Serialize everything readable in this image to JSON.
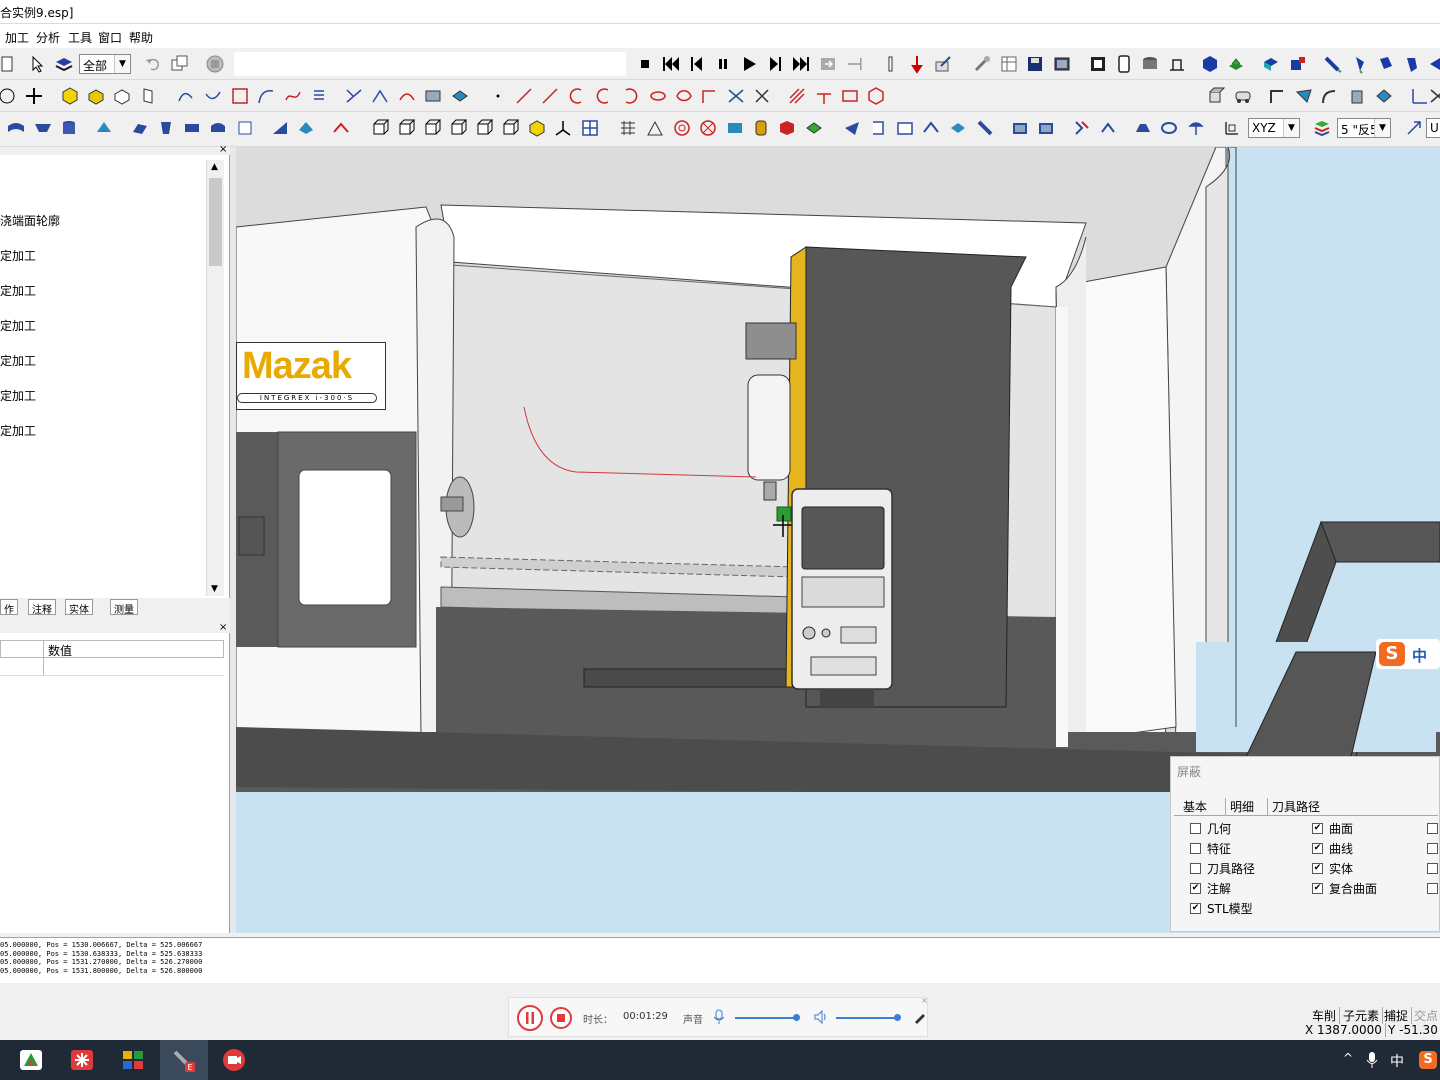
{
  "titlebar": {
    "title": "合实例9.esp]"
  },
  "menu": [
    "加工",
    "分析",
    "工具",
    "窗口",
    "帮助"
  ],
  "toolbar1": {
    "layer_combo": "全部"
  },
  "toolbar3": {
    "coord_combo": "XYZ",
    "view_combo": "5 \"反5"
  },
  "tree": {
    "items": [
      "浇端面轮廓",
      "定加工",
      "定加工",
      "定加工",
      "定加工",
      "定加工",
      "定加工"
    ]
  },
  "left_tabs": [
    "作",
    "注释",
    "实体",
    "测量"
  ],
  "props": {
    "header_value": "数值"
  },
  "viewport": {
    "brand": "Mazak",
    "model": "INTEGREX i-300·S"
  },
  "ime": {
    "label": "中"
  },
  "shield": {
    "title": "屏蔽",
    "tabs": [
      "基本",
      "明细",
      "刀具路径"
    ],
    "left_items": [
      {
        "label": "几何",
        "checked": false
      },
      {
        "label": "特征",
        "checked": false
      },
      {
        "label": "刀具路径",
        "checked": false
      },
      {
        "label": "注解",
        "checked": true
      },
      {
        "label": "STL模型",
        "checked": true
      }
    ],
    "right_items": [
      {
        "label": "曲面",
        "checked": true
      },
      {
        "label": "曲线",
        "checked": true
      },
      {
        "label": "实体",
        "checked": true
      },
      {
        "label": "复合曲面",
        "checked": true
      }
    ]
  },
  "output": {
    "lines": [
      "05.000000, Pos = 1530.006667, Delta = 525.006667",
      "05.000000, Pos = 1530.638333, Delta = 525.638333",
      "05.000000, Pos = 1531.270000, Delta = 526.270000",
      "05.000000, Pos = 1531.800000, Delta = 526.800000"
    ]
  },
  "recorder": {
    "duration_label": "时长：",
    "duration": "00:01:29",
    "sound_label": "声音"
  },
  "status": {
    "buttons": [
      "车削",
      "子元素",
      "捕捉",
      "交点"
    ],
    "x": "X 1387.0000",
    "y": "Y -51.30"
  },
  "tray": {
    "ime": "中"
  }
}
